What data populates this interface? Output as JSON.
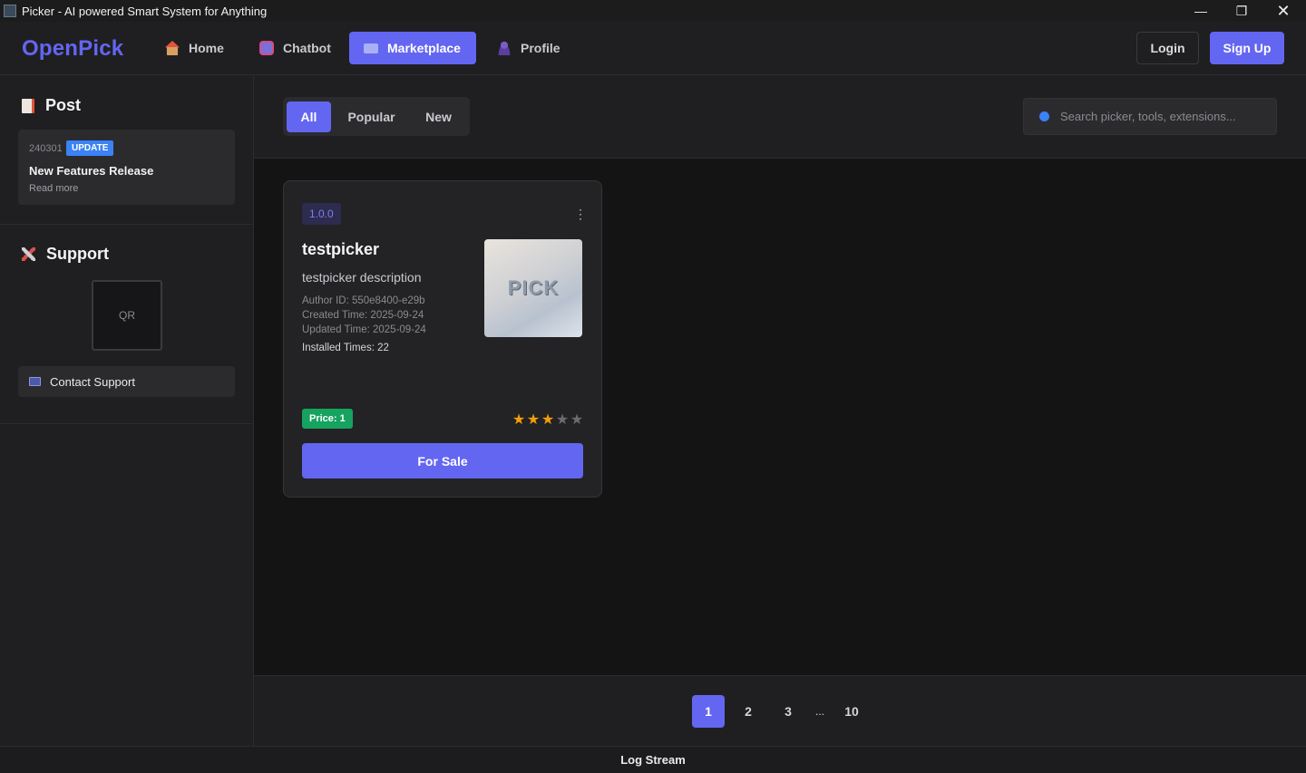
{
  "window": {
    "title": "Picker - AI powered Smart System for Anything"
  },
  "navbar": {
    "logo": "OpenPick",
    "items": [
      {
        "label": "Home",
        "icon": "home-icon"
      },
      {
        "label": "Chatbot",
        "icon": "robot-icon"
      },
      {
        "label": "Marketplace",
        "icon": "keyboard-icon",
        "active": true
      },
      {
        "label": "Profile",
        "icon": "user-icon"
      }
    ],
    "login": "Login",
    "signup": "Sign Up"
  },
  "sidebar": {
    "post": {
      "heading": "Post",
      "card": {
        "date": "240301",
        "badge": "UPDATE",
        "title": "New Features Release",
        "more": "Read more"
      }
    },
    "support": {
      "heading": "Support",
      "qr": "QR",
      "contact": "Contact Support"
    }
  },
  "filters": {
    "tabs": [
      {
        "label": "All",
        "active": true
      },
      {
        "label": "Popular"
      },
      {
        "label": "New"
      }
    ],
    "search_placeholder": "Search picker, tools, extensions..."
  },
  "cards": [
    {
      "version": "1.0.0",
      "name": "testpicker",
      "description": "testpicker description",
      "author": "Author ID: 550e8400-e29b",
      "created": "Created Time: 2025-09-24",
      "updated": "Updated Time: 2025-09-24",
      "installed": "Installed Times: 22",
      "thumb_text": "PICK",
      "price": "Price: 1",
      "rating": 3,
      "rating_max": 5,
      "action": "For Sale"
    }
  ],
  "pagination": {
    "pages": [
      "1",
      "2",
      "3",
      "...",
      "10"
    ],
    "current": "1"
  },
  "footer": {
    "log_stream": "Log Stream"
  },
  "colors": {
    "accent": "#6366f1",
    "badge_blue": "#3b82f6",
    "price_green": "#16a35f",
    "star": "#f59e0b"
  }
}
